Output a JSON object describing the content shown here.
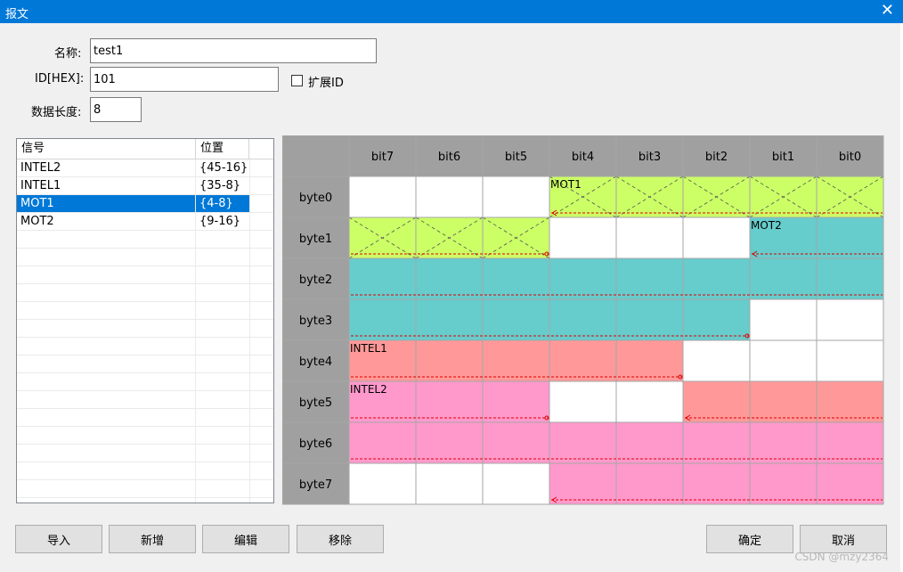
{
  "window": {
    "title": "报文",
    "close_glyph": "✕"
  },
  "form": {
    "name_label": "名称:",
    "name_value": "test1",
    "id_label": "ID[HEX]:",
    "id_value": "101",
    "extended_id_label": "扩展ID",
    "extended_id_checked": false,
    "length_label": "数据长度:",
    "length_value": "8"
  },
  "signal_list": {
    "headers": [
      "信号",
      "位置"
    ],
    "rows": [
      {
        "name": "INTEL2",
        "position": "{45-16}"
      },
      {
        "name": "INTEL1",
        "position": "{35-8}"
      },
      {
        "name": "MOT1",
        "position": "{4-8}"
      },
      {
        "name": "MOT2",
        "position": "{9-16}"
      }
    ],
    "selected_index": 2
  },
  "grid": {
    "bit_headers": [
      "bit7",
      "bit6",
      "bit5",
      "bit4",
      "bit3",
      "bit2",
      "bit1",
      "bit0"
    ],
    "byte_headers": [
      "byte0",
      "byte1",
      "byte2",
      "byte3",
      "byte4",
      "byte5",
      "byte6",
      "byte7"
    ],
    "signals": [
      {
        "name": "MOT1",
        "color": "#ccff66",
        "crossed": true,
        "bits": [
          [
            0,
            4
          ],
          [
            0,
            3
          ],
          [
            0,
            2
          ],
          [
            0,
            1
          ],
          [
            0,
            0
          ],
          [
            1,
            7
          ],
          [
            1,
            6
          ],
          [
            1,
            5
          ]
        ],
        "label_cell": [
          0,
          4
        ],
        "arrow_start": [
          0,
          4
        ],
        "arrow_end": [
          1,
          5
        ]
      },
      {
        "name": "MOT2",
        "color": "#66cccc",
        "crossed": false,
        "bits": [
          [
            1,
            1
          ],
          [
            1,
            0
          ],
          [
            2,
            7
          ],
          [
            2,
            6
          ],
          [
            2,
            5
          ],
          [
            2,
            4
          ],
          [
            2,
            3
          ],
          [
            2,
            2
          ],
          [
            2,
            1
          ],
          [
            2,
            0
          ],
          [
            3,
            7
          ],
          [
            3,
            6
          ],
          [
            3,
            5
          ],
          [
            3,
            4
          ],
          [
            3,
            3
          ],
          [
            3,
            2
          ]
        ],
        "label_cell": [
          1,
          1
        ],
        "arrow_start": [
          1,
          1
        ],
        "arrow_end": [
          3,
          2
        ]
      },
      {
        "name": "INTEL1",
        "color": "#ff9999",
        "crossed": false,
        "bits": [
          [
            4,
            7
          ],
          [
            4,
            6
          ],
          [
            4,
            5
          ],
          [
            4,
            4
          ],
          [
            4,
            3
          ],
          [
            5,
            2
          ],
          [
            5,
            1
          ],
          [
            5,
            0
          ]
        ],
        "label_cell": [
          4,
          7
        ],
        "arrow_start": [
          5,
          2
        ],
        "arrow_end": [
          4,
          3
        ]
      },
      {
        "name": "INTEL2",
        "color": "#ff99cc",
        "crossed": false,
        "bits": [
          [
            5,
            7
          ],
          [
            5,
            6
          ],
          [
            5,
            5
          ],
          [
            6,
            7
          ],
          [
            6,
            6
          ],
          [
            6,
            5
          ],
          [
            6,
            4
          ],
          [
            6,
            3
          ],
          [
            6,
            2
          ],
          [
            6,
            1
          ],
          [
            6,
            0
          ],
          [
            7,
            4
          ],
          [
            7,
            3
          ],
          [
            7,
            2
          ],
          [
            7,
            1
          ],
          [
            7,
            0
          ]
        ],
        "label_cell": [
          5,
          7
        ],
        "arrow_start": [
          7,
          4
        ],
        "arrow_end": [
          5,
          5
        ]
      }
    ],
    "colors": {
      "header_bg": "#a0a0a0",
      "cell_bg": "#ffffff",
      "grid_line": "#a6a6a6",
      "arrow": "#e00000"
    }
  },
  "buttons": {
    "import": "导入",
    "add": "新增",
    "edit": "编辑",
    "remove": "移除",
    "ok": "确定",
    "cancel": "取消"
  },
  "watermark": "CSDN @mzy2364"
}
